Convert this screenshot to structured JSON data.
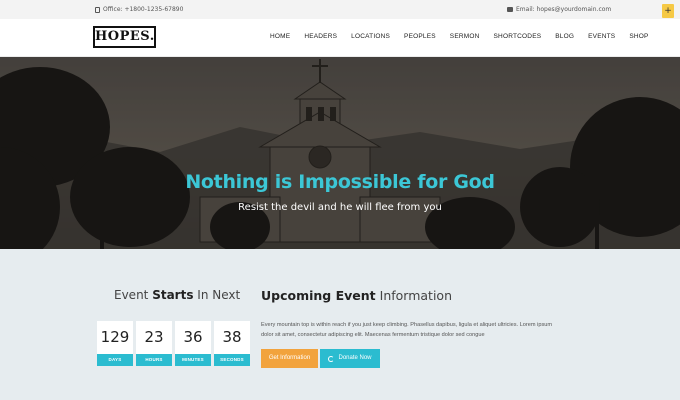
{
  "topbar": {
    "phone": "Office: +1800-1235-67890",
    "email": "Email: hopes@yourdomain.com",
    "plus_label": "+"
  },
  "header": {
    "logo": "HOPES.",
    "nav": [
      "HOME",
      "HEADERS",
      "LOCATIONS",
      "PEOPLES",
      "SERMON",
      "SHORTCODES",
      "BLOG",
      "EVENTS",
      "SHOP"
    ]
  },
  "hero": {
    "title": "Nothing is Impossible for God",
    "subtitle": "Resist the devil and he will flee from you"
  },
  "event": {
    "left_title_pre": "Event ",
    "left_title_bold": "Starts",
    "left_title_post": " In Next",
    "right_title_bold": "Upcoming Event",
    "right_title_post": " Information",
    "countdown": [
      {
        "value": "129",
        "label": "DAYS"
      },
      {
        "value": "23",
        "label": "HOURS"
      },
      {
        "value": "36",
        "label": "MINUTES"
      },
      {
        "value": "38",
        "label": "SECONDS"
      }
    ],
    "description_line1": "Every mountain top is within reach if you just keep climbing. Phasellus dapibus, ligula et aliquet ultricies. Lorem ipsum",
    "description_line2": "dolor sit amet, consectetur adipiscing elit. Maecenas fermentum tristique dolor sed congue",
    "info_button": "Get Information",
    "donate_button": "Donate Now"
  },
  "colors": {
    "accent": "#2bbcd0",
    "hero_title": "#3cc7d6",
    "info_button": "#f2a33d",
    "topbar_plus": "#f6c945"
  }
}
